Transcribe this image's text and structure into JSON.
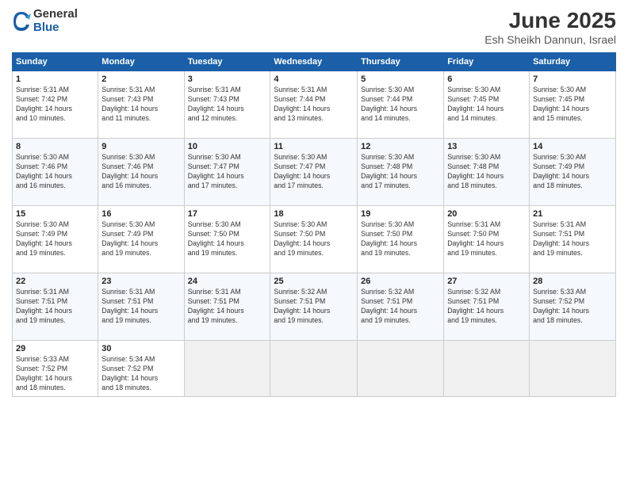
{
  "logo": {
    "general": "General",
    "blue": "Blue"
  },
  "title": "June 2025",
  "location": "Esh Sheikh Dannun, Israel",
  "days_of_week": [
    "Sunday",
    "Monday",
    "Tuesday",
    "Wednesday",
    "Thursday",
    "Friday",
    "Saturday"
  ],
  "weeks": [
    [
      {
        "day": "1",
        "info": "Sunrise: 5:31 AM\nSunset: 7:42 PM\nDaylight: 14 hours\nand 10 minutes."
      },
      {
        "day": "2",
        "info": "Sunrise: 5:31 AM\nSunset: 7:43 PM\nDaylight: 14 hours\nand 11 minutes."
      },
      {
        "day": "3",
        "info": "Sunrise: 5:31 AM\nSunset: 7:43 PM\nDaylight: 14 hours\nand 12 minutes."
      },
      {
        "day": "4",
        "info": "Sunrise: 5:31 AM\nSunset: 7:44 PM\nDaylight: 14 hours\nand 13 minutes."
      },
      {
        "day": "5",
        "info": "Sunrise: 5:30 AM\nSunset: 7:44 PM\nDaylight: 14 hours\nand 14 minutes."
      },
      {
        "day": "6",
        "info": "Sunrise: 5:30 AM\nSunset: 7:45 PM\nDaylight: 14 hours\nand 14 minutes."
      },
      {
        "day": "7",
        "info": "Sunrise: 5:30 AM\nSunset: 7:45 PM\nDaylight: 14 hours\nand 15 minutes."
      }
    ],
    [
      {
        "day": "8",
        "info": "Sunrise: 5:30 AM\nSunset: 7:46 PM\nDaylight: 14 hours\nand 16 minutes."
      },
      {
        "day": "9",
        "info": "Sunrise: 5:30 AM\nSunset: 7:46 PM\nDaylight: 14 hours\nand 16 minutes."
      },
      {
        "day": "10",
        "info": "Sunrise: 5:30 AM\nSunset: 7:47 PM\nDaylight: 14 hours\nand 17 minutes."
      },
      {
        "day": "11",
        "info": "Sunrise: 5:30 AM\nSunset: 7:47 PM\nDaylight: 14 hours\nand 17 minutes."
      },
      {
        "day": "12",
        "info": "Sunrise: 5:30 AM\nSunset: 7:48 PM\nDaylight: 14 hours\nand 17 minutes."
      },
      {
        "day": "13",
        "info": "Sunrise: 5:30 AM\nSunset: 7:48 PM\nDaylight: 14 hours\nand 18 minutes."
      },
      {
        "day": "14",
        "info": "Sunrise: 5:30 AM\nSunset: 7:49 PM\nDaylight: 14 hours\nand 18 minutes."
      }
    ],
    [
      {
        "day": "15",
        "info": "Sunrise: 5:30 AM\nSunset: 7:49 PM\nDaylight: 14 hours\nand 19 minutes."
      },
      {
        "day": "16",
        "info": "Sunrise: 5:30 AM\nSunset: 7:49 PM\nDaylight: 14 hours\nand 19 minutes."
      },
      {
        "day": "17",
        "info": "Sunrise: 5:30 AM\nSunset: 7:50 PM\nDaylight: 14 hours\nand 19 minutes."
      },
      {
        "day": "18",
        "info": "Sunrise: 5:30 AM\nSunset: 7:50 PM\nDaylight: 14 hours\nand 19 minutes."
      },
      {
        "day": "19",
        "info": "Sunrise: 5:30 AM\nSunset: 7:50 PM\nDaylight: 14 hours\nand 19 minutes."
      },
      {
        "day": "20",
        "info": "Sunrise: 5:31 AM\nSunset: 7:50 PM\nDaylight: 14 hours\nand 19 minutes."
      },
      {
        "day": "21",
        "info": "Sunrise: 5:31 AM\nSunset: 7:51 PM\nDaylight: 14 hours\nand 19 minutes."
      }
    ],
    [
      {
        "day": "22",
        "info": "Sunrise: 5:31 AM\nSunset: 7:51 PM\nDaylight: 14 hours\nand 19 minutes."
      },
      {
        "day": "23",
        "info": "Sunrise: 5:31 AM\nSunset: 7:51 PM\nDaylight: 14 hours\nand 19 minutes."
      },
      {
        "day": "24",
        "info": "Sunrise: 5:31 AM\nSunset: 7:51 PM\nDaylight: 14 hours\nand 19 minutes."
      },
      {
        "day": "25",
        "info": "Sunrise: 5:32 AM\nSunset: 7:51 PM\nDaylight: 14 hours\nand 19 minutes."
      },
      {
        "day": "26",
        "info": "Sunrise: 5:32 AM\nSunset: 7:51 PM\nDaylight: 14 hours\nand 19 minutes."
      },
      {
        "day": "27",
        "info": "Sunrise: 5:32 AM\nSunset: 7:51 PM\nDaylight: 14 hours\nand 19 minutes."
      },
      {
        "day": "28",
        "info": "Sunrise: 5:33 AM\nSunset: 7:52 PM\nDaylight: 14 hours\nand 18 minutes."
      }
    ],
    [
      {
        "day": "29",
        "info": "Sunrise: 5:33 AM\nSunset: 7:52 PM\nDaylight: 14 hours\nand 18 minutes."
      },
      {
        "day": "30",
        "info": "Sunrise: 5:34 AM\nSunset: 7:52 PM\nDaylight: 14 hours\nand 18 minutes."
      },
      null,
      null,
      null,
      null,
      null
    ]
  ]
}
